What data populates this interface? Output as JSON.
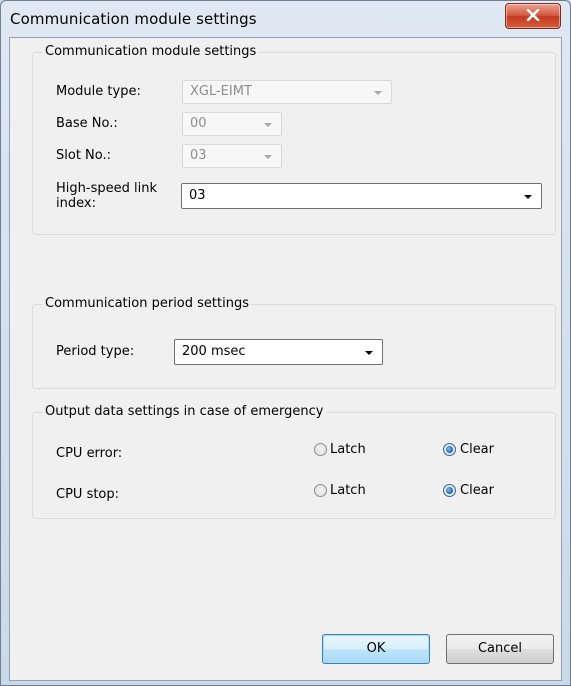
{
  "window": {
    "title": "Communication module settings"
  },
  "module_settings": {
    "legend": "Communication module settings",
    "module_type_label": "Module type:",
    "module_type_value": "XGL-EIMT",
    "base_no_label": "Base No.:",
    "base_no_value": "00",
    "slot_no_label": "Slot No.:",
    "slot_no_value": "03",
    "hs_link_label_line1": "High-speed link",
    "hs_link_label_line2": "index:",
    "hs_link_value": "03"
  },
  "period_settings": {
    "legend": "Communication period settings",
    "period_type_label": "Period type:",
    "period_type_value": "200 msec"
  },
  "emergency_settings": {
    "legend": "Output data settings in case of emergency",
    "rows": [
      {
        "label": "CPU error:",
        "latch_label": "Latch",
        "clear_label": "Clear",
        "selected": "Clear"
      },
      {
        "label": "CPU stop:",
        "latch_label": "Latch",
        "clear_label": "Clear",
        "selected": "Clear"
      }
    ]
  },
  "buttons": {
    "ok": "OK",
    "cancel": "Cancel"
  },
  "icons": {
    "close": "close-icon"
  },
  "colors": {
    "close_button": "#d5583f",
    "default_button_border": "#3c7fb1",
    "radio_selected": "#1b63a8"
  }
}
